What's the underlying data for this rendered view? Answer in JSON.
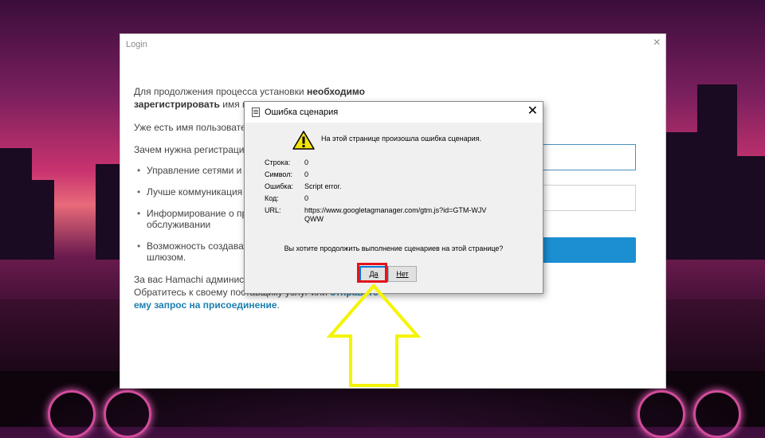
{
  "login": {
    "title": "Login",
    "close": "×",
    "lead_pre": "Для продолжения процесса установки ",
    "lead_bold1": "необходимо",
    "lead_bold2": "зарегистрировать",
    "lead_post": " имя по",
    "link_right": "я",
    "have_account": "Уже есть имя пользовате",
    "why": "Зачем нужна регистрация",
    "bullets": [
      "Управление сетями и а",
      "Лучше коммуникация и",
      "Информирование о пре обслуживании",
      "Возможность создават со шлюзом."
    ],
    "admin_line1": "За вас Hamachi администрирует другое лицо?",
    "admin_line2": "Обратитесь к своему поставщику услуг или ",
    "admin_link1": "отправьте",
    "admin_link2": "ему запрос на присоединение",
    "admin_end": "."
  },
  "dialog": {
    "title": "Ошибка сценария",
    "close": "✕",
    "message": "На этой странице произошла ошибка сценария.",
    "rows": [
      {
        "key": "Строка:",
        "value": "0"
      },
      {
        "key": "Символ:",
        "value": "0"
      },
      {
        "key": "Ошибка:",
        "value": "Script error."
      },
      {
        "key": "Код:",
        "value": "0"
      },
      {
        "key": "URL:",
        "value": "https://www.googletagmanager.com/gtm.js?id=GTM-WJVQWW"
      }
    ],
    "question": "Вы хотите продолжить выполнение сценариев на этой странице?",
    "yes_label": "Да",
    "no_label": "Нет"
  },
  "colors": {
    "highlight": "#e3141c",
    "arrow": "#f4f400",
    "link": "#1a7fb0",
    "button_blue": "#1b8fd2"
  },
  "icons": {
    "warning": "warning-icon",
    "document": "document-icon"
  }
}
